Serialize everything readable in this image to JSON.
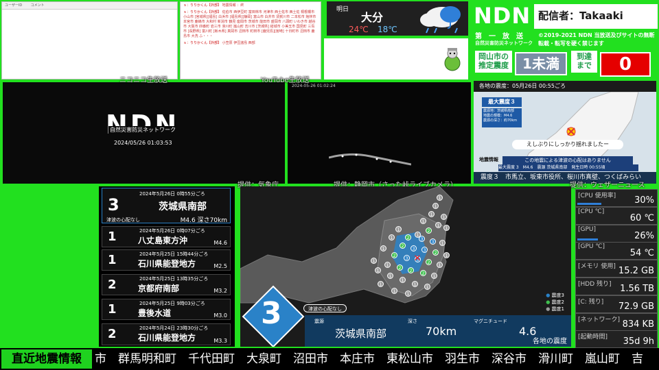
{
  "comments": {
    "col_user": "ユーザーID",
    "col_comment": "コメント"
  },
  "youtube": {
    "messages": [
      {
        "user": "ｓ：りりかくん【外部】",
        "text": "地震情報 ：終"
      },
      {
        "user": "ｓ：りりかくん【外部】",
        "text": "佐伯市 西伊豆町 富田林市 河津市 西土佐市 西土佐 桐根橋市 小山市 [宮城県][福島] 白浜市 [福島県][静岡] 富山市 白井市 須賀川市 二本松市 館林市 本宮市 鹿嶋市 大和村 新潟市 鶴見 座間市 茨城市 能田市 盛岡市 八頭町 いわき市 越谷市 大阪市 四番町 岩三市 滑川町 嵐山町 吉川市 [茨城県] 結城市 小美玉市 国見町 三島市 [長野県] 富川町 [栃木県] 真岡市 沼田市 町田市 [鹿児島][宮崎] 十日町市 沼田市 鹿島市 大洗 ふ・・・"
      },
      {
        "user": "ｓ：りりかくん【外部】",
        "text": "小笠原 伊豆諸島 西部"
      }
    ]
  },
  "weather": {
    "day": "明日",
    "area": "大分",
    "high": "24℃",
    "low": "18℃"
  },
  "ndn": {
    "logo": "NDN",
    "broadcaster": "配信者：Takaaki",
    "dai": "第　一　放　送",
    "subtitle": "自然災害防災ネットワーク",
    "copyright": "©2019-2021 NDN 当放送及びサイトの無断転載・転写を硬く禁じます",
    "est_label": "岡山市の推定震度",
    "est_value": "1未満",
    "arrival_label": "到達まで",
    "arrival_value": "0"
  },
  "videos": {
    "niconico_label": "ニコニコ生放送",
    "youtube_label": "YouTube生放送",
    "ndn_logo": "NDN",
    "ndn_sub": "自然災害防災ネットワーク",
    "ndn_time": "2024/05/26 01:03:53",
    "cam_time": "2024-05-26 01:02:24",
    "source1": "提供：気象庁",
    "source2": "提供：静岡市（さった峠ライブカメラ）",
    "source3": "提供：ウェザーニュース"
  },
  "weathernews": {
    "header": "各地の震度：05月26日 00:55ごろ",
    "max_label": "最大震度３",
    "info": "震源地：茨城県南部\n地震の規模：M4.6\n震源の深さ：約70km",
    "banner": "えしぶりにしっかり揺れましたー",
    "tsunami": "この地震による津波の心配はありません",
    "quake_info": "地震情報",
    "row": "最大震度 3　M4.6　震源 茨城県南部　発生日時 00:55頃",
    "ticker": "震度３　市馬立、坂東市役所、桜川市真壁、つくばみらい"
  },
  "quakes": [
    {
      "date": "2024年5月26日 0時55分ごろ",
      "intensity": "3",
      "place": "茨城県南部",
      "mag": "M4.6 深さ70km",
      "tsunami": "津波の心配なし"
    },
    {
      "date": "2024年5月26日 0時07分ごろ",
      "intensity": "1",
      "place": "八丈島東方沖",
      "mag": "M4.6"
    },
    {
      "date": "2024年5月25日 15時44分ごろ",
      "intensity": "1",
      "place": "石川県能登地方",
      "mag": "M2.5"
    },
    {
      "date": "2024年5月25日 13時35分ごろ",
      "intensity": "2",
      "place": "京都府南部",
      "mag": "M3.2"
    },
    {
      "date": "2024年5月25日 9時03分ごろ",
      "intensity": "1",
      "place": "豊後水道",
      "mag": "M3.0"
    },
    {
      "date": "2024年5月24日 23時30分ごろ",
      "intensity": "2",
      "place": "石川県能登地方",
      "mag": "M3.3"
    }
  ],
  "map": {
    "intensity": "3",
    "tsunami": "津波の心配なし",
    "epi_label": "震源",
    "epi_value": "茨城県南部",
    "depth_label": "深さ",
    "depth_value": "70km",
    "mag_label": "マグニチュード",
    "mag_value": "4.6",
    "caption": "各地の震度",
    "legend": [
      "震度3",
      "震度2",
      "震度1"
    ]
  },
  "stats": [
    {
      "key": "[CPU 使用率]",
      "value": "30%",
      "pct": 30
    },
    {
      "key": "[CPU ℃]",
      "value": "60 ℃"
    },
    {
      "key": "[GPU]",
      "value": "26%",
      "pct": 26
    },
    {
      "key": "[GPU ℃]",
      "value": "54 ℃"
    },
    {
      "key": "[メモリ 使用]",
      "value": "15.2 GB"
    },
    {
      "key": "[HDD 残り]",
      "value": "1.56 TB"
    },
    {
      "key": "[C: 残り]",
      "value": "72.9 GB"
    },
    {
      "key": "[ネットワーク]",
      "value": "834 KB"
    },
    {
      "key": "[起動時間]",
      "value": "35d 9h"
    }
  ],
  "ticker": {
    "title": "直近地震情報",
    "text": "市　群馬明和町　千代田町　大泉町　沼田市　本庄市　東松山市　羽生市　深谷市　滑川町　嵐山町　吉"
  },
  "colors": {
    "background": "#22e01f",
    "intensity3": "#2a82c8",
    "intensity2": "#3fbf4f",
    "intensity1": "#9a9a9a",
    "alert": "#e50000"
  }
}
